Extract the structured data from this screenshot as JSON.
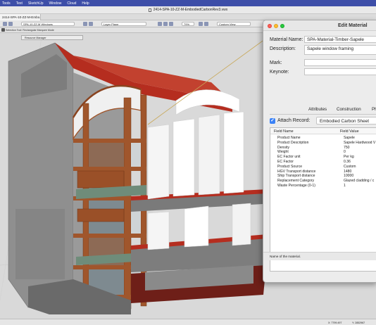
{
  "menubar": {
    "items": [
      "Tools",
      "Text",
      "SketchUp",
      "Window",
      "Cloud",
      "Help"
    ]
  },
  "window": {
    "title": "2414-SPA-10-ZZ-M-EmbodiedCarbonRev3.vwx"
  },
  "tabs": [
    "2414-SPA-10-ZZ-M-Embo..."
  ],
  "viewbar": {
    "design_layer": "SPA-10-ZZ-M Windows",
    "layer_plane": "Layer Plane",
    "zoom": "79%",
    "view": "Custom View"
  },
  "toolrow": {
    "hint": "Selection Tool: Rectangular Marquee Mode"
  },
  "resource_manager": {
    "label": "Resource Manager"
  },
  "statusbar": {
    "x": "X: 7799.497",
    "y": "Y: 2852967"
  },
  "dialog": {
    "title": "Edit Material",
    "material_name_label": "Material Name:",
    "material_name_value": "SPA-Material-Timber-Sapele",
    "description_label": "Description:",
    "description_value": "Sapele window framing",
    "mark_label": "Mark:",
    "mark_value": "",
    "keynote_label": "Keynote:",
    "keynote_value": "",
    "tabs": [
      "Attributes",
      "Construction",
      "Ph"
    ],
    "attach_record_label": "Attach Record:",
    "attach_record_checked": true,
    "record_name": "Embodied Carbon Sheet",
    "field_header": "Field Name",
    "value_header": "Field Value",
    "fields": [
      {
        "name": "Product Name",
        "value": "Sapele"
      },
      {
        "name": "Product Description",
        "value": "Sapele Hardwood V"
      },
      {
        "name": "Density",
        "value": "750"
      },
      {
        "name": "Weight",
        "value": "0"
      },
      {
        "name": "EC Factor unit",
        "value": "Per kg"
      },
      {
        "name": "EC Factor",
        "value": "0.36"
      },
      {
        "name": "Product Source",
        "value": "Custom"
      },
      {
        "name": "HGV Transport distance",
        "value": "1480"
      },
      {
        "name": "Ship Transport distance",
        "value": "10000"
      },
      {
        "name": "Replacement Category",
        "value": "Glazed cladding / c"
      },
      {
        "name": "Waste Percentage (0-1)",
        "value": "1"
      }
    ],
    "status_text": "Name of the material.",
    "colors": {
      "close": "#fe5f57",
      "minimize": "#febb2e",
      "zoom": "#28c840",
      "checkbox": "#3b82f6"
    }
  },
  "scene": {
    "colors": {
      "timber": "#a0562c",
      "concrete": "#8f8f8f",
      "slab": "#b52d1f",
      "glass": "#9aa6ad",
      "wall": "#f2f2f2"
    }
  }
}
